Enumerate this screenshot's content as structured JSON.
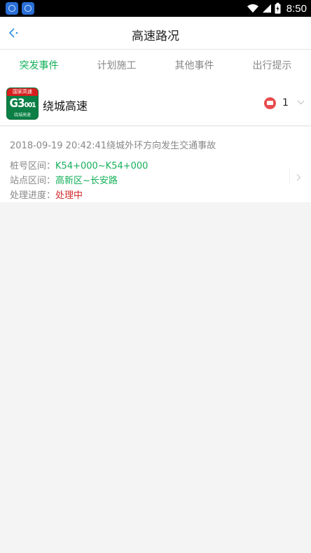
{
  "status_bar": {
    "time": "8:50"
  },
  "header": {
    "title": "高速路况"
  },
  "tabs": [
    {
      "label": "突发事件",
      "active": true
    },
    {
      "label": "计划施工",
      "active": false
    },
    {
      "label": "其他事件",
      "active": false
    },
    {
      "label": "出行提示",
      "active": false
    }
  ],
  "highway": {
    "shield_top": "国家高速",
    "shield_code": "G3",
    "shield_code_small": "001",
    "shield_bottom": "绕城高速",
    "name": "绕城高速",
    "event_count": "1"
  },
  "event": {
    "headline": "2018-09-19 20:42:41绕城外环方向发生交通事故",
    "stake_label": "桩号区间：",
    "stake_value": "K54+000~K54+000",
    "station_label": "站点区间：",
    "station_value": "高新区~长安路",
    "progress_label": "处理进度：",
    "progress_value": "处理中"
  },
  "colors": {
    "accent": "#14b05a",
    "alert": "#d22b2b",
    "shield": "#0b7f45"
  }
}
